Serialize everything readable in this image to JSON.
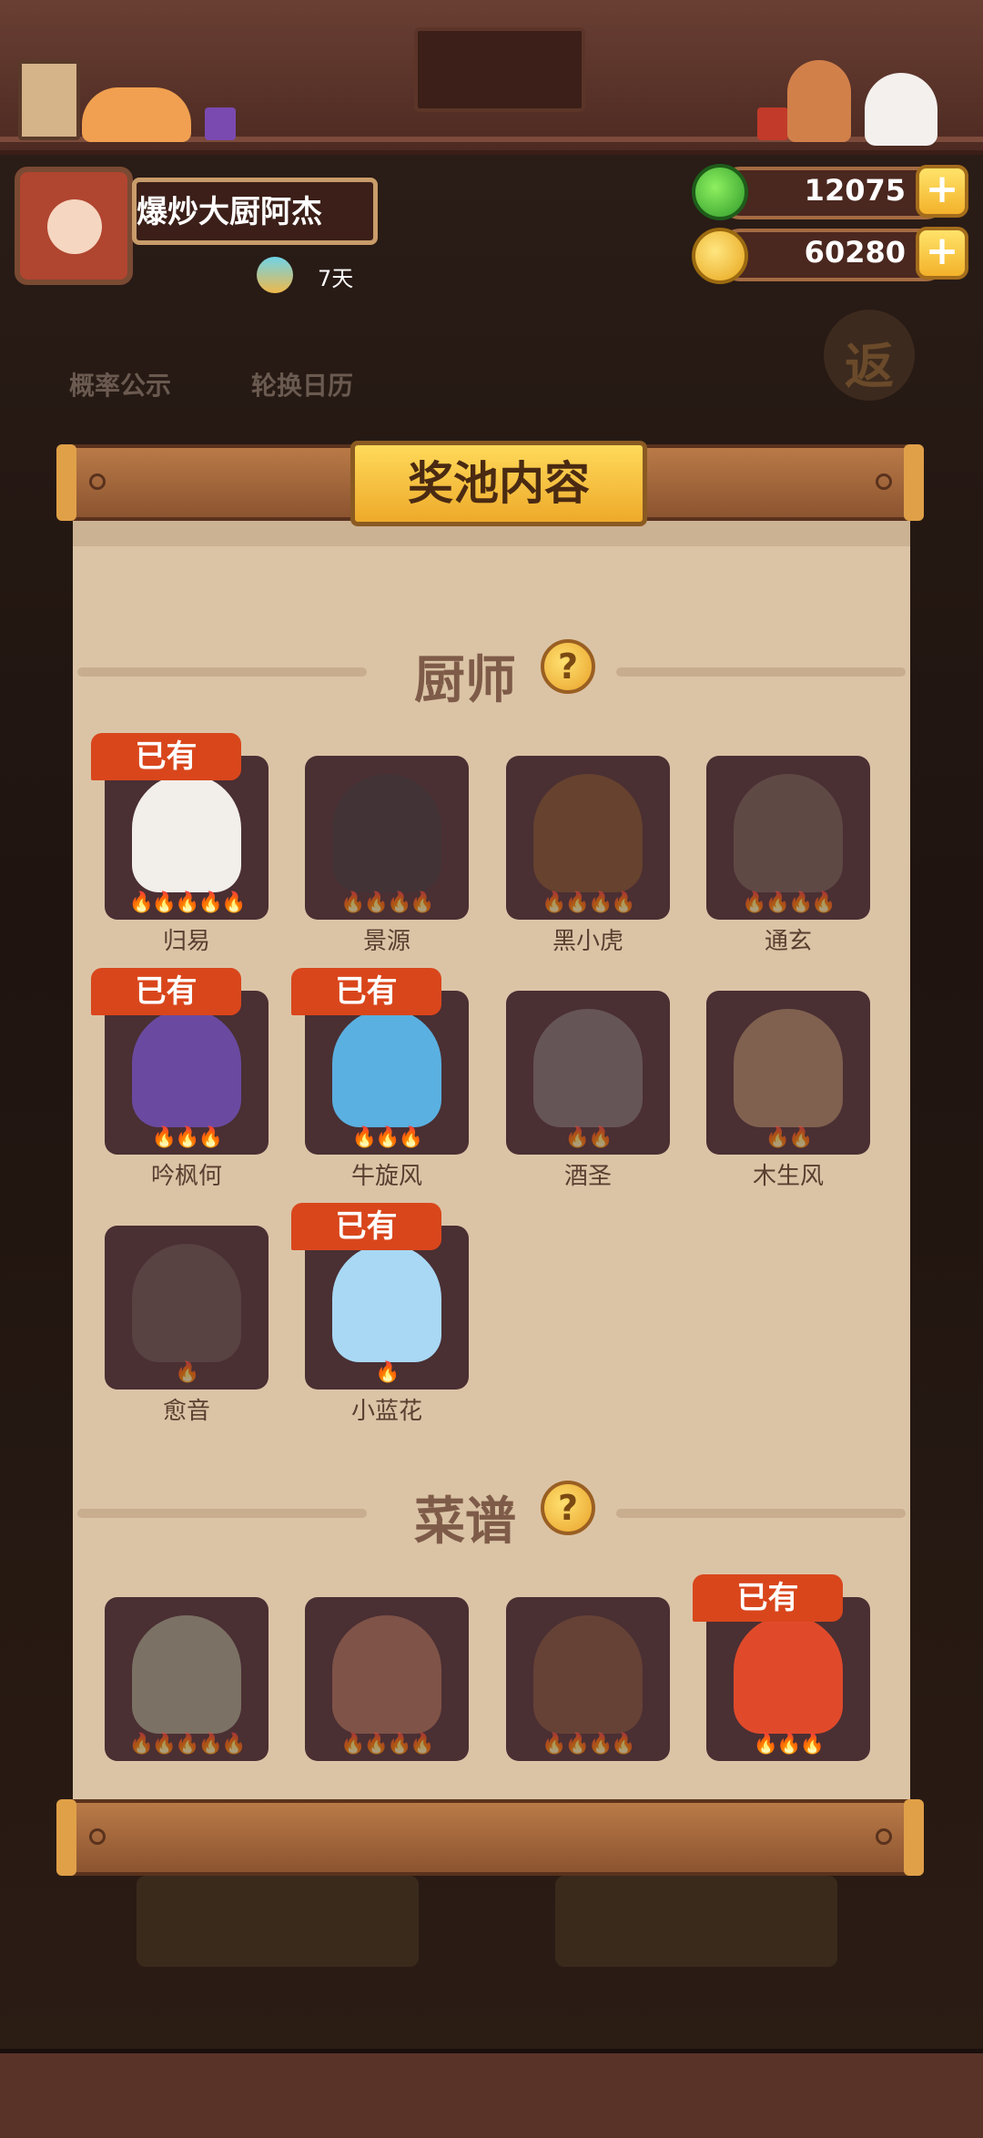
{
  "profile": {
    "name": "爆炒大厨阿杰",
    "days": "7天"
  },
  "currency": {
    "jade": "12075",
    "coins": "60280",
    "plus": "+"
  },
  "background": {
    "prob": "概率公示",
    "calendar": "轮换日历",
    "icon_char": "返"
  },
  "panel": {
    "title": "奖池内容",
    "help": "?"
  },
  "chefs": {
    "title": "厨师",
    "items": [
      {
        "name": "归易",
        "owned": true,
        "badge": "已有",
        "flames": "🔥🔥🔥🔥🔥",
        "color": "#f2eeea"
      },
      {
        "name": "景源",
        "owned": false,
        "flames": "🔥🔥🔥🔥",
        "color": "#3a3a3a"
      },
      {
        "name": "黑小虎",
        "owned": false,
        "flames": "🔥🔥🔥🔥",
        "color": "#8a5a2a"
      },
      {
        "name": "通玄",
        "owned": false,
        "flames": "🔥🔥🔥🔥",
        "color": "#7a6a5a"
      },
      {
        "name": "吟枫何",
        "owned": true,
        "badge": "已有",
        "flames": "🔥🔥🔥",
        "color": "#6a4aa0"
      },
      {
        "name": "牛旋风",
        "owned": true,
        "badge": "已有",
        "flames": "🔥🔥🔥",
        "color": "#5ab0e0"
      },
      {
        "name": "酒圣",
        "owned": false,
        "flames": "🔥🔥",
        "color": "#8a8480"
      },
      {
        "name": "木生风",
        "owned": false,
        "flames": "🔥🔥",
        "color": "#c4a070"
      },
      {
        "name": "愈音",
        "owned": false,
        "flames": "🔥",
        "color": "#6a5a54"
      },
      {
        "name": "小蓝花",
        "owned": true,
        "badge": "已有",
        "flames": "🔥",
        "color": "#a8d8f4"
      }
    ]
  },
  "recipes": {
    "title": "菜谱",
    "items": [
      {
        "owned": false,
        "flames": "🔥🔥🔥🔥🔥",
        "color": "#b8c4a0"
      },
      {
        "owned": false,
        "flames": "🔥🔥🔥🔥",
        "color": "#c08060"
      },
      {
        "owned": false,
        "flames": "🔥🔥🔥🔥",
        "color": "#8a5a3a"
      },
      {
        "owned": true,
        "badge": "已有",
        "flames": "🔥🔥🔥",
        "color": "#e04a2a"
      }
    ]
  },
  "colors": {
    "accent_badge": "#d9461c",
    "panel": "#dbc4a6",
    "card": "#4a2f33"
  }
}
